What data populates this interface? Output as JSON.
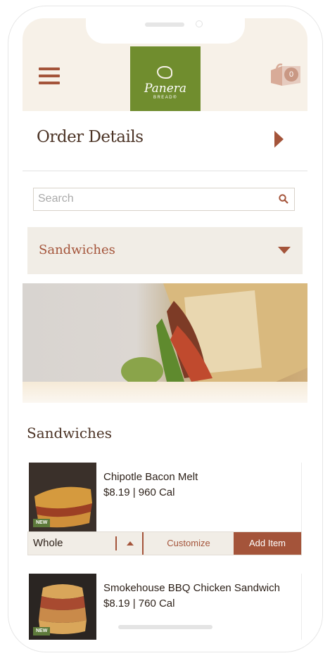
{
  "header": {
    "brand_name": "Panera",
    "brand_sub": "BREAD®",
    "bag_count": "0"
  },
  "order": {
    "title": "Order Details"
  },
  "search": {
    "placeholder": "Search"
  },
  "category": {
    "selected": "Sandwiches"
  },
  "section": {
    "title": "Sandwiches"
  },
  "items": [
    {
      "name": "Chipotle Bacon Melt",
      "price_cal": "$8.19 | 960 Cal",
      "badge": "NEW",
      "size": "Whole",
      "customize_label": "Customize",
      "add_label": "Add Item"
    },
    {
      "name": "Smokehouse BBQ Chicken Sandwich",
      "price_cal": "$8.19 | 760 Cal",
      "badge": "NEW"
    }
  ],
  "colors": {
    "accent": "#a4543a",
    "brand_green": "#708d2e",
    "header_bg": "#f7f1e8",
    "panel_bg": "#f1ede6",
    "text_dark": "#4b3325"
  }
}
